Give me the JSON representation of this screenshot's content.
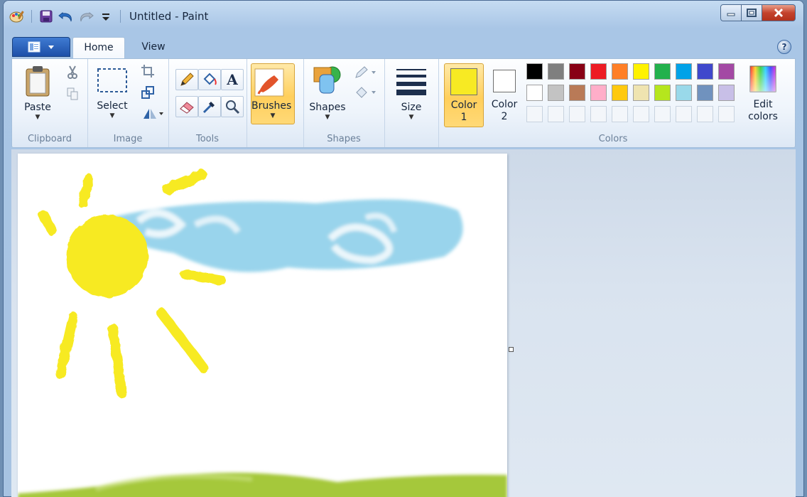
{
  "window": {
    "title": "Untitled - Paint"
  },
  "tabs": [
    {
      "label": "Home",
      "active": true
    },
    {
      "label": "View",
      "active": false
    }
  ],
  "help": {
    "label": "?"
  },
  "groups": {
    "clipboard": {
      "label": "Clipboard",
      "paste_label": "Paste"
    },
    "image": {
      "label": "Image",
      "select_label": "Select"
    },
    "tools": {
      "label": "Tools",
      "text_glyph": "A"
    },
    "brushes": {
      "label": "Brushes"
    },
    "shapes": {
      "label": "Shapes",
      "button_label": "Shapes"
    },
    "size": {
      "label": "Size"
    },
    "colors": {
      "label": "Colors",
      "color1_label_line1": "Color",
      "color1_label_line2": "1",
      "color2_label_line1": "Color",
      "color2_label_line2": "2",
      "edit_label_line1": "Edit",
      "edit_label_line2": "colors",
      "color1_value": "#f7ea23",
      "color2_value": "#ffffff"
    }
  },
  "palette": {
    "row1": [
      "#000000",
      "#7f7f7f",
      "#880015",
      "#ed1c24",
      "#ff7f27",
      "#fff200",
      "#22b14c",
      "#00a2e8",
      "#3f48cc",
      "#a349a4"
    ],
    "row2": [
      "#ffffff",
      "#c3c3c3",
      "#b97a57",
      "#ffaec9",
      "#ffc90e",
      "#efe4b0",
      "#b5e61d",
      "#99d9ea",
      "#7092be",
      "#c8bfe7"
    ],
    "row3_empty_count": 10
  },
  "canvas_colors": {
    "sun": "#f7ea23",
    "cloud": "#8fd0ea",
    "grass": "#a5c83a"
  }
}
